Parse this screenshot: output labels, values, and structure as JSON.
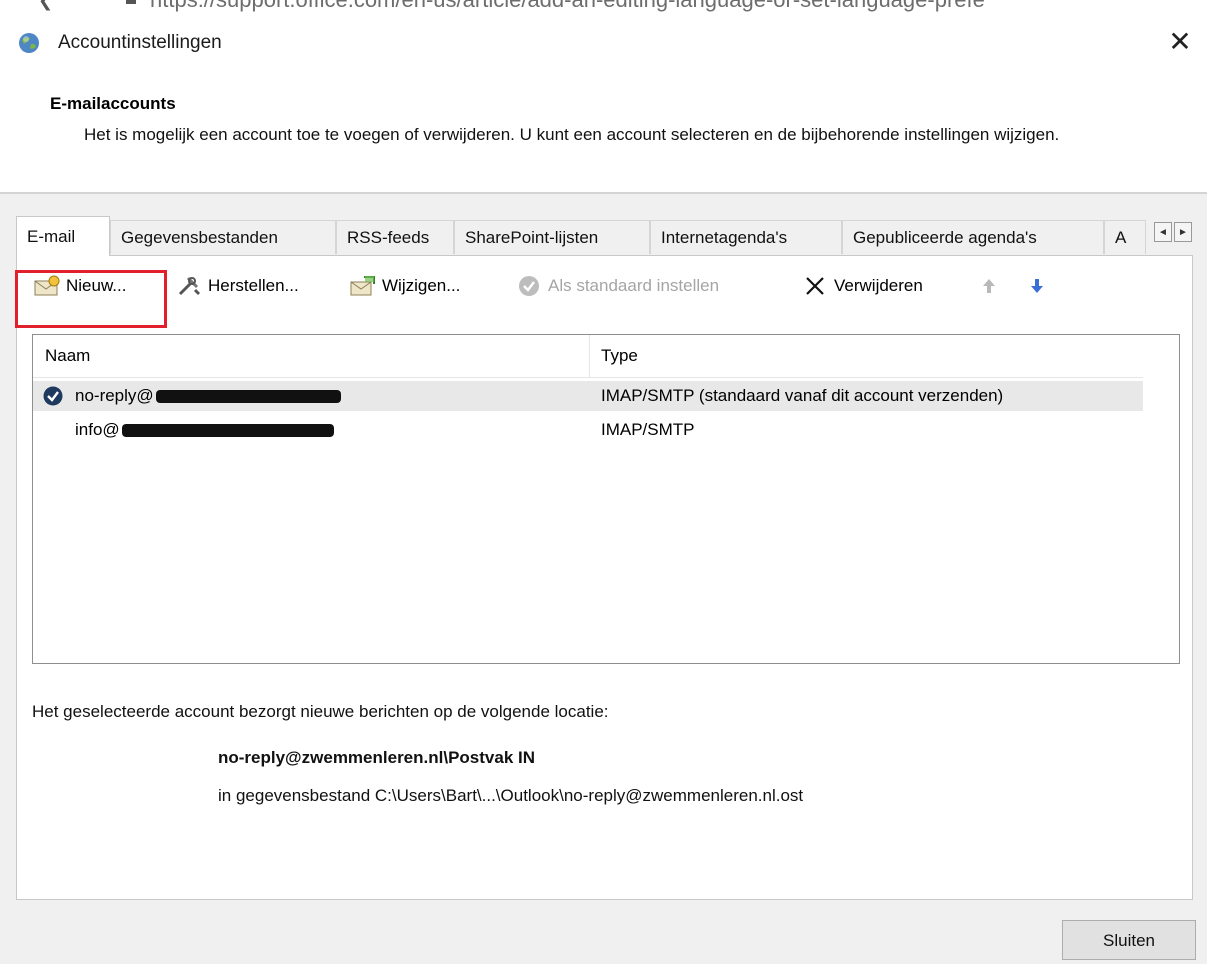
{
  "browser": {
    "url_fragment": "https://support.office.com/en-us/article/add-an-editing-language-or-set-language-prefe"
  },
  "window": {
    "title": "Accountinstellingen",
    "close_label": "✕"
  },
  "header": {
    "title": "E-mailaccounts",
    "description": "Het is mogelijk een account toe te voegen of verwijderen. U kunt een account selecteren en de bijbehorende instellingen wijzigen."
  },
  "tabs": [
    {
      "label": "E-mail",
      "active": true
    },
    {
      "label": "Gegevensbestanden"
    },
    {
      "label": "RSS-feeds"
    },
    {
      "label": "SharePoint-lijsten"
    },
    {
      "label": "Internetagenda's"
    },
    {
      "label": "Gepubliceerde agenda's"
    },
    {
      "label": "A"
    }
  ],
  "tab_scroll": {
    "left": "◄",
    "right": "►"
  },
  "toolbar": {
    "new_label": "Nieuw...",
    "repair_label": "Herstellen...",
    "change_label": "Wijzigen...",
    "set_default_label": "Als standaard instellen",
    "remove_label": "Verwijderen",
    "move_up_label": "",
    "move_down_label": ""
  },
  "accounts": {
    "columns": [
      "Naam",
      "Type"
    ],
    "rows": [
      {
        "name": "no-reply@",
        "type": "IMAP/SMTP (standaard vanaf dit account verzenden)",
        "default": true
      },
      {
        "name": "info@",
        "type": "IMAP/SMTP",
        "default": false
      }
    ]
  },
  "location": {
    "label": "Het geselecteerde account bezorgt nieuwe berichten op de volgende locatie:",
    "folder": "no-reply@zwemmenleren.nl\\Postvak IN",
    "file": "in gegevensbestand C:\\Users\\Bart\\...\\Outlook\\no-reply@zwemmenleren.nl.ost"
  },
  "footer": {
    "close_button": "Sluiten"
  },
  "colors": {
    "highlight": "#e0212b",
    "selected_row": "#e8e8e8",
    "default_check": "#1f3a5f",
    "arrow_up": "#b9b9b9",
    "arrow_down": "#3b6fd8"
  },
  "icons": [
    "app-globe-icon",
    "close-icon",
    "new-account-icon",
    "repair-icon",
    "change-icon",
    "check-circle-icon",
    "remove-icon",
    "arrow-up-icon",
    "arrow-down-icon"
  ]
}
